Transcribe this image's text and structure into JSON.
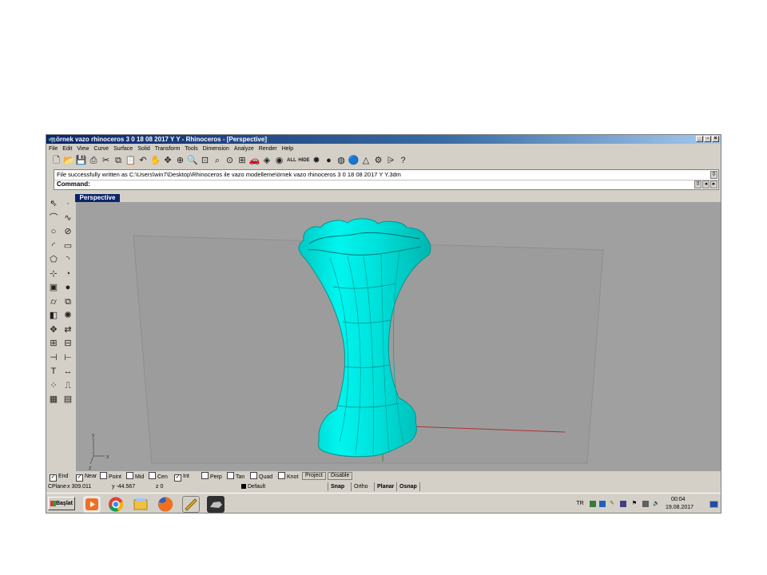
{
  "window": {
    "title": "örnek vazo rhinoceros 3 0 18 08 2017 Y Y - Rhinoceros - [Perspective]",
    "controls": [
      "_",
      "▫",
      "×"
    ]
  },
  "menu": [
    "File",
    "Edit",
    "View",
    "Curve",
    "Surface",
    "Solid",
    "Transform",
    "Tools",
    "Dimension",
    "Analyze",
    "Render",
    "Help"
  ],
  "toolbar_icons": [
    {
      "name": "new-file-icon",
      "glyph": "🗋"
    },
    {
      "name": "open-file-icon",
      "glyph": "📂"
    },
    {
      "name": "save-icon",
      "glyph": "💾"
    },
    {
      "name": "print-icon",
      "glyph": "⎙"
    },
    {
      "name": "cut-icon",
      "glyph": "✂"
    },
    {
      "name": "copy-icon",
      "glyph": "⧉"
    },
    {
      "name": "paste-icon",
      "glyph": "📋"
    },
    {
      "name": "undo-icon",
      "glyph": "↶"
    },
    {
      "name": "pan-hand-icon",
      "glyph": "✋"
    },
    {
      "name": "rotate-view-icon",
      "glyph": "✥"
    },
    {
      "name": "zoom-dynamic-icon",
      "glyph": "⊕"
    },
    {
      "name": "zoom-window-icon",
      "glyph": "🔍"
    },
    {
      "name": "zoom-extents-icon",
      "glyph": "⊡"
    },
    {
      "name": "zoom-selected-icon",
      "glyph": "⌕"
    },
    {
      "name": "zoom-target-icon",
      "glyph": "⊙"
    },
    {
      "name": "four-viewports-icon",
      "glyph": "⊞"
    },
    {
      "name": "car-object-icon",
      "glyph": "🚗"
    },
    {
      "name": "hide-objects-icon",
      "glyph": "◈"
    },
    {
      "name": "show-objects-icon",
      "glyph": "◉"
    },
    {
      "name": "show-all-label",
      "glyph": "ALL"
    },
    {
      "name": "hide-label",
      "glyph": "HIDE"
    },
    {
      "name": "color-wheel-icon",
      "glyph": "✹"
    },
    {
      "name": "shaded-sphere-icon",
      "glyph": "●"
    },
    {
      "name": "render-sphere-icon",
      "glyph": "◍"
    },
    {
      "name": "blue-sphere-icon",
      "glyph": "🔵"
    },
    {
      "name": "light-icon",
      "glyph": "△"
    },
    {
      "name": "settings-gear-icon",
      "glyph": "⚙"
    },
    {
      "name": "layer-icon",
      "glyph": "⩥"
    },
    {
      "name": "help-icon",
      "glyph": "?"
    }
  ],
  "command": {
    "history": "File successfully written as C:\\Users\\win7\\Desktop\\Rhinoceros ile vazo modelleme\\örnek vazo rhinoceros 3 0 18 08 2017 Y Y.3dm",
    "prompt": "Command:"
  },
  "left_toolbar_icons": [
    "select-arrow-icon",
    "point-icon",
    "polyline-icon",
    "curve-icon",
    "circle-icon",
    "ellipse-icon",
    "arc-icon",
    "rectangle-icon",
    "polygon-icon",
    "fillet-curve-icon",
    "surface-point-icon",
    "surface-edit-icon",
    "box-icon",
    "sphere-icon",
    "cylinder-icon",
    "extrude-icon",
    "boolean-icon",
    "explode-icon",
    "move-icon",
    "mirror-icon",
    "array-icon",
    "grid-icon",
    "split-icon",
    "trim-icon",
    "text-icon",
    "dimension-icon",
    "control-points-icon",
    "analyze-icon",
    "render-icon",
    "properties-icon"
  ],
  "viewport": {
    "label": "Perspective",
    "axis_y": "y",
    "axis_x": "x",
    "axis_z": "z",
    "background": "#a0a0a0",
    "object_color": "#00e5e0"
  },
  "osnap": [
    {
      "label": "End",
      "checked": true
    },
    {
      "label": "Near",
      "checked": true
    },
    {
      "label": "Point",
      "checked": false
    },
    {
      "label": "Mid",
      "checked": false
    },
    {
      "label": "Cen",
      "checked": false
    },
    {
      "label": "Int",
      "checked": true
    },
    {
      "label": "Perp",
      "checked": false
    },
    {
      "label": "Tan",
      "checked": false
    },
    {
      "label": "Quad",
      "checked": false
    },
    {
      "label": "Knot",
      "checked": false
    }
  ],
  "osnap_buttons": [
    "Project",
    "Disable"
  ],
  "status": {
    "cplane": "CPlane",
    "x": "x 309.011",
    "y": "y -44.567",
    "z": "z 0",
    "layer": "Default",
    "snap": "Snap",
    "ortho": "Ortho",
    "planar": "Planar",
    "osnap": "Osnap"
  },
  "taskbar": {
    "start": "Başlat",
    "lang": "TR",
    "time": "00:04",
    "date": "19.08.2017"
  }
}
